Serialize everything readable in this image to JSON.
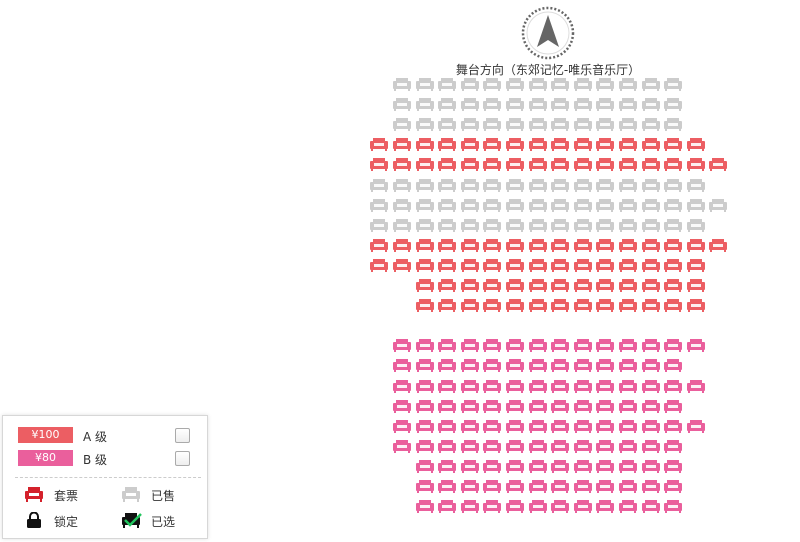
{
  "stage": {
    "label": "舞台方向（东郊记忆-唯乐音乐厅）",
    "compass_icon": "arrow-up-compass-icon"
  },
  "colors": {
    "grade_a": "#ec5e63",
    "grade_b": "#ea5f9c",
    "sold": "#cccccc",
    "package": "#d4212b",
    "locked": "#111111",
    "selected_check": "#22c55e"
  },
  "seat_map": {
    "rows": [
      {
        "grade": "sold",
        "cols": [
          0,
          1,
          2,
          3,
          4,
          5,
          6,
          7,
          8,
          9,
          10,
          11,
          12
        ]
      },
      {
        "grade": "sold",
        "cols": [
          0,
          1,
          2,
          3,
          4,
          5,
          6,
          7,
          8,
          9,
          10,
          11,
          12
        ]
      },
      {
        "grade": "sold",
        "cols": [
          0,
          1,
          2,
          3,
          4,
          5,
          6,
          7,
          8,
          9,
          10,
          11,
          12
        ]
      },
      {
        "grade": "a",
        "cols": [
          -1,
          0,
          1,
          2,
          3,
          4,
          5,
          6,
          7,
          8,
          9,
          10,
          11,
          12,
          13
        ]
      },
      {
        "grade": "a",
        "cols": [
          -1,
          0,
          1,
          2,
          3,
          4,
          5,
          6,
          7,
          8,
          9,
          10,
          11,
          12,
          13,
          14
        ]
      },
      {
        "grade": "sold",
        "cols": [
          -1,
          0,
          1,
          2,
          3,
          4,
          5,
          6,
          7,
          8,
          9,
          10,
          11,
          12,
          13
        ]
      },
      {
        "grade": "sold",
        "cols": [
          -1,
          0,
          1,
          2,
          3,
          4,
          5,
          6,
          7,
          8,
          9,
          10,
          11,
          12,
          13,
          14
        ]
      },
      {
        "grade": "sold",
        "cols": [
          -1,
          0,
          1,
          2,
          3,
          4,
          5,
          6,
          7,
          8,
          9,
          10,
          11,
          12,
          13
        ]
      },
      {
        "grade": "a",
        "cols": [
          -1,
          0,
          1,
          2,
          3,
          4,
          5,
          6,
          7,
          8,
          9,
          10,
          11,
          12,
          13,
          14
        ]
      },
      {
        "grade": "a",
        "cols": [
          -1,
          0,
          1,
          2,
          3,
          4,
          5,
          6,
          7,
          8,
          9,
          10,
          11,
          12,
          13
        ]
      },
      {
        "grade": "a",
        "cols": [
          1,
          2,
          3,
          4,
          5,
          6,
          7,
          8,
          9,
          10,
          11,
          12,
          13
        ]
      },
      {
        "grade": "a",
        "cols": [
          1,
          2,
          3,
          4,
          5,
          6,
          7,
          8,
          9,
          10,
          11,
          12,
          13
        ]
      },
      {
        "grade": "gap",
        "cols": []
      },
      {
        "grade": "b",
        "cols": [
          0,
          1,
          2,
          3,
          4,
          5,
          6,
          7,
          8,
          9,
          10,
          11,
          12,
          13
        ]
      },
      {
        "grade": "b",
        "cols": [
          0,
          1,
          2,
          3,
          4,
          5,
          6,
          7,
          8,
          9,
          10,
          11,
          12
        ]
      },
      {
        "grade": "b",
        "cols": [
          0,
          1,
          2,
          3,
          4,
          5,
          6,
          7,
          8,
          9,
          10,
          11,
          12,
          13
        ]
      },
      {
        "grade": "b",
        "cols": [
          0,
          1,
          2,
          3,
          4,
          5,
          6,
          7,
          8,
          9,
          10,
          11,
          12
        ]
      },
      {
        "grade": "b",
        "cols": [
          0,
          1,
          2,
          3,
          4,
          5,
          6,
          7,
          8,
          9,
          10,
          11,
          12,
          13
        ]
      },
      {
        "grade": "b",
        "cols": [
          0,
          1,
          2,
          3,
          4,
          5,
          6,
          7,
          8,
          9,
          10,
          11,
          12
        ]
      },
      {
        "grade": "b",
        "cols": [
          1,
          2,
          3,
          4,
          5,
          6,
          7,
          8,
          9,
          10,
          11,
          12
        ]
      },
      {
        "grade": "b",
        "cols": [
          1,
          2,
          3,
          4,
          5,
          6,
          7,
          8,
          9,
          10,
          11,
          12
        ]
      },
      {
        "grade": "b",
        "cols": [
          1,
          2,
          3,
          4,
          5,
          6,
          7,
          8,
          9,
          10,
          11,
          12
        ]
      }
    ]
  },
  "legend": {
    "grades": [
      {
        "price": "¥100",
        "label": "A 级",
        "color": "#ec5e63",
        "checked": false
      },
      {
        "price": "¥80",
        "label": "B 级",
        "color": "#ea5f9c",
        "checked": false
      }
    ],
    "status": {
      "package": {
        "label": "套票",
        "icon": "package-seat-icon"
      },
      "sold": {
        "label": "已售",
        "icon": "sold-seat-icon"
      },
      "locked": {
        "label": "锁定",
        "icon": "lock-icon"
      },
      "selected": {
        "label": "已选",
        "icon": "selected-seat-icon"
      }
    }
  }
}
